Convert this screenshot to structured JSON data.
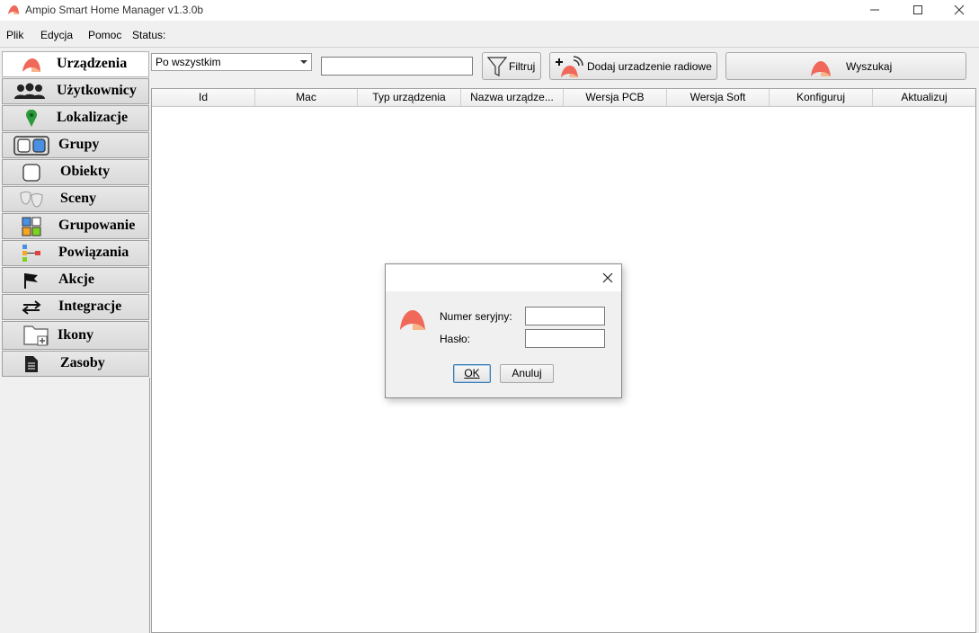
{
  "window": {
    "title": "Ampio Smart Home Manager v1.3.0b",
    "controls": {
      "minimize": "—",
      "maximize": "☐",
      "close": "✕"
    }
  },
  "menubar": {
    "items": [
      "Plik",
      "Edycja",
      "Pomoc",
      "Status:"
    ]
  },
  "sidebar": {
    "items": [
      {
        "label": "Urządzenia",
        "icon": "ampio-logo-icon",
        "active": true
      },
      {
        "label": "Użytkownicy",
        "icon": "users-icon"
      },
      {
        "label": "Lokalizacje",
        "icon": "map-pin-icon"
      },
      {
        "label": "Grupy",
        "icon": "groups-icon"
      },
      {
        "label": "Obiekty",
        "icon": "object-icon"
      },
      {
        "label": "Sceny",
        "icon": "theater-masks-icon"
      },
      {
        "label": "Grupowanie",
        "icon": "grouping-icon"
      },
      {
        "label": "Powiązania",
        "icon": "links-icon"
      },
      {
        "label": "Akcje",
        "icon": "flag-icon"
      },
      {
        "label": "Integracje",
        "icon": "swap-arrows-icon"
      },
      {
        "label": "Ikony",
        "icon": "add-folder-icon"
      },
      {
        "label": "Zasoby",
        "icon": "document-icon"
      }
    ]
  },
  "toolbar": {
    "filter_select": "Po wszystkim",
    "search_value": "",
    "filter_button": "Filtruj",
    "add_radio_button": "Dodaj urzadzenie radiowe",
    "search_button": "Wyszukaj"
  },
  "table": {
    "columns": [
      "Id",
      "Mac",
      "Typ urządzenia",
      "Nazwa urządze...",
      "Wersja PCB",
      "Wersja Soft",
      "Konfiguruj",
      "Aktualizuj"
    ],
    "rows": []
  },
  "dialog": {
    "serial_label": "Numer seryjny:",
    "password_label": "Hasło:",
    "serial_value": "",
    "password_value": "",
    "ok_button": "OK",
    "cancel_button": "Anuluj"
  },
  "colors": {
    "brand_orange": "#f0685a",
    "brand_peach": "#f7b58a"
  }
}
